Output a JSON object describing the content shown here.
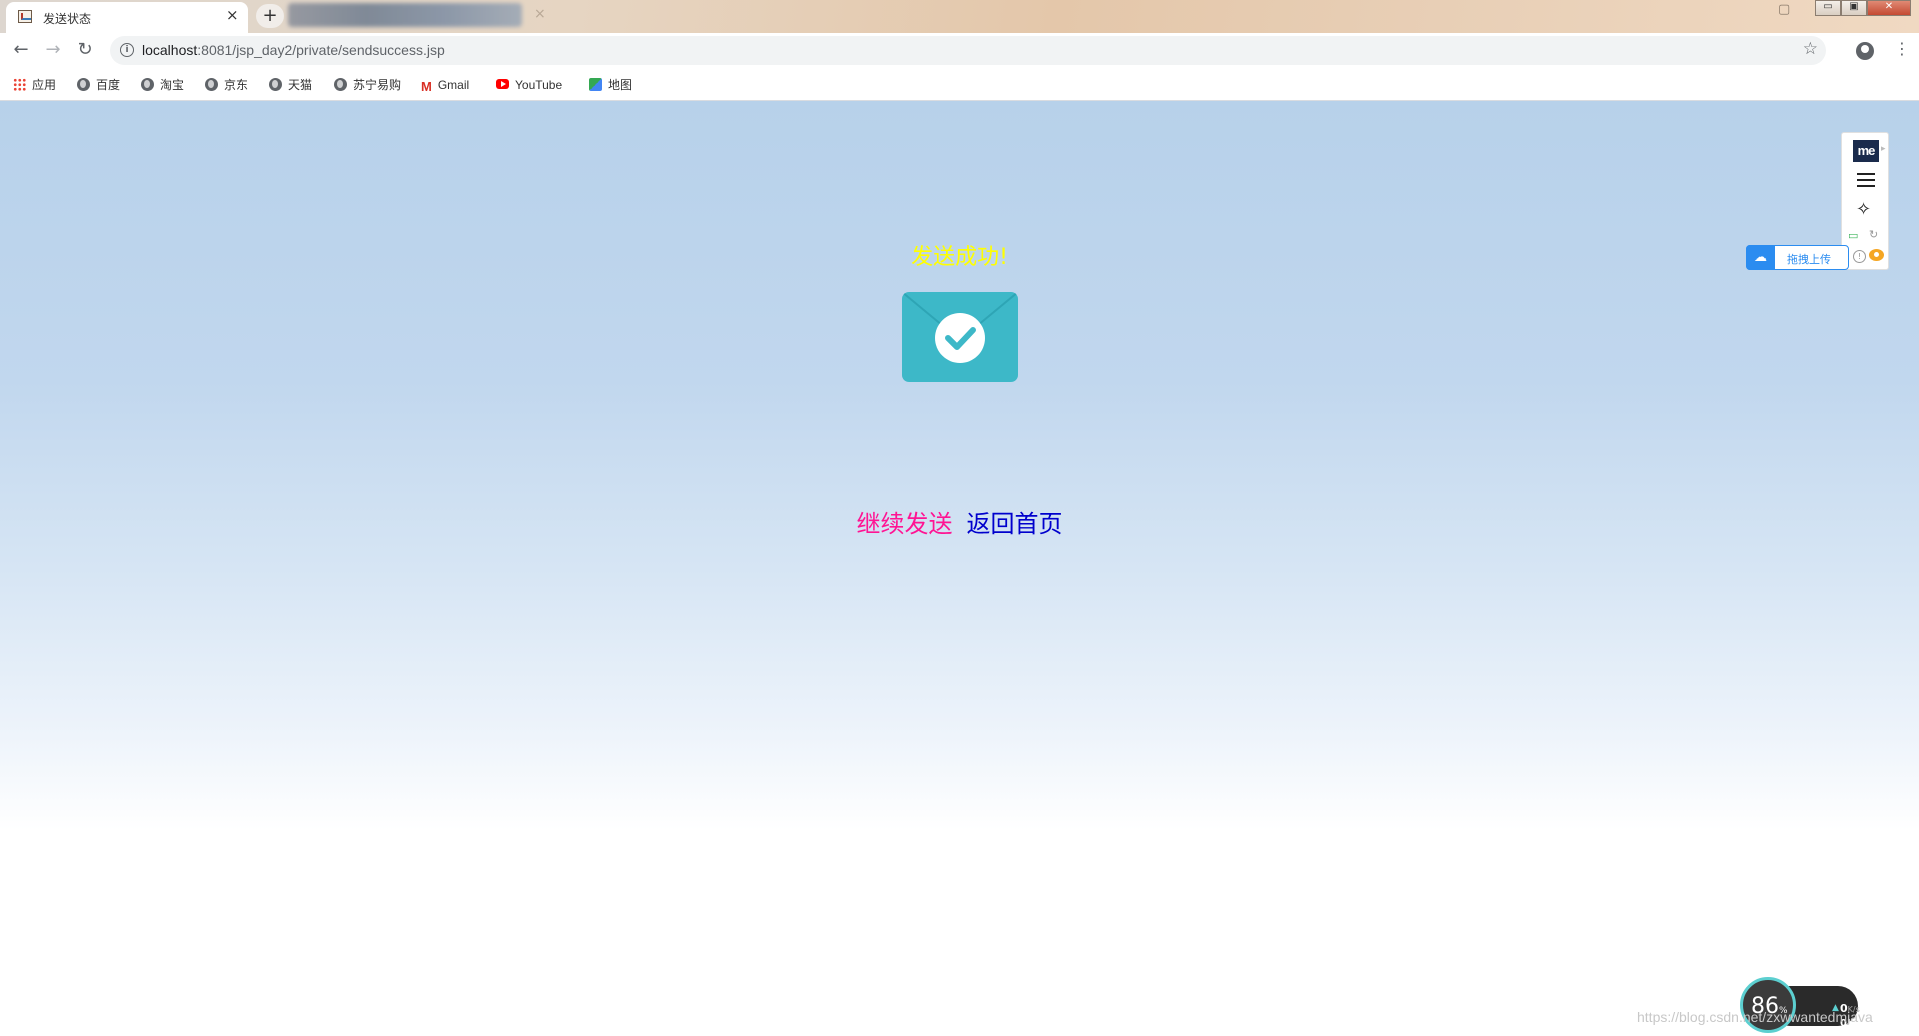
{
  "browser": {
    "tab_title": "发送状态",
    "tab_close": "×",
    "new_tab": "+",
    "blurred_tab_close": "×",
    "window_controls": {
      "minimize": "▭",
      "restore": "▣",
      "close": "✕"
    },
    "nav": {
      "back": "←",
      "forward": "→",
      "reload": "↻"
    },
    "url_host": "localhost",
    "url_path": ":8081/jsp_day2/private/sendsuccess.jsp",
    "info_glyph": "i",
    "star_glyph": "☆",
    "menu_glyph": "⋮",
    "bookmarks": [
      {
        "label": "应用",
        "icon": "apps-icon"
      },
      {
        "label": "百度",
        "icon": "globe-icon"
      },
      {
        "label": "淘宝",
        "icon": "globe-icon"
      },
      {
        "label": "京东",
        "icon": "globe-icon"
      },
      {
        "label": "天猫",
        "icon": "globe-icon"
      },
      {
        "label": "苏宁易购",
        "icon": "globe-icon"
      },
      {
        "label": "Gmail",
        "icon": "gmail-icon"
      },
      {
        "label": "YouTube",
        "icon": "youtube-icon"
      },
      {
        "label": "地图",
        "icon": "maps-icon"
      }
    ]
  },
  "page": {
    "title": "发送成功!",
    "links": {
      "continue_send": "继续发送",
      "back_home": "返回首页"
    },
    "colors": {
      "title": "#ffff00",
      "continue_send": "#ff1493",
      "back_home": "#0000cd",
      "envelope": "#3db8c8"
    }
  },
  "extension": {
    "logo_text": "me",
    "upload_label": "拖拽上传"
  },
  "speed_widget": {
    "percent": "86",
    "percent_unit": "%",
    "upload_rate": "0",
    "rate_unit": "K/s",
    "download_rate": "0K/s"
  },
  "watermark": "https://blog.csdn.net/zxwwantedmjava"
}
